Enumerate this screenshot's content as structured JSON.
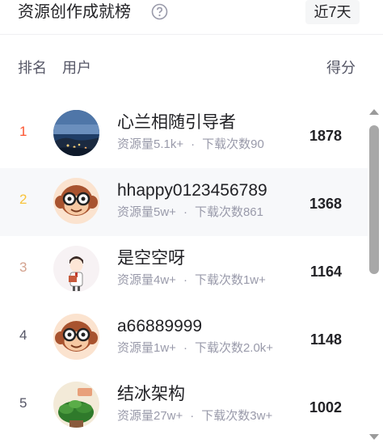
{
  "header": {
    "title": "资源创作成就榜",
    "help_icon": "question-circle-icon",
    "period": "近7天"
  },
  "columns": {
    "rank": "排名",
    "user": "用户",
    "score": "得分"
  },
  "colors": {
    "rank_1": "#fc5531",
    "rank_2": "#f8c33b",
    "rank_3": "#d4a38f",
    "rank_other": "#555666",
    "muted": "#999aaa"
  },
  "rows": [
    {
      "rank": "1",
      "name": "心兰相随引导者",
      "resources": "资源量5.1k+",
      "downloads": "下载次数90",
      "score": "1878",
      "avatar": "night-coast-avatar"
    },
    {
      "rank": "2",
      "name": "hhappy0123456789",
      "resources": "资源量5w+",
      "downloads": "下载次数861",
      "score": "1368",
      "avatar": "monkey-glasses-avatar"
    },
    {
      "rank": "3",
      "name": "是空空呀",
      "resources": "资源量4w+",
      "downloads": "下载次数1w+",
      "score": "1164",
      "avatar": "cartoon-boy-avatar"
    },
    {
      "rank": "4",
      "name": "a66889999",
      "resources": "资源量1w+",
      "downloads": "下载次数2.0k+",
      "score": "1148",
      "avatar": "monkey-glasses-avatar"
    },
    {
      "rank": "5",
      "name": "结冰架构",
      "resources": "资源量27w+",
      "downloads": "下载次数3w+",
      "score": "1002",
      "avatar": "green-plant-avatar"
    }
  ],
  "separator": "·"
}
